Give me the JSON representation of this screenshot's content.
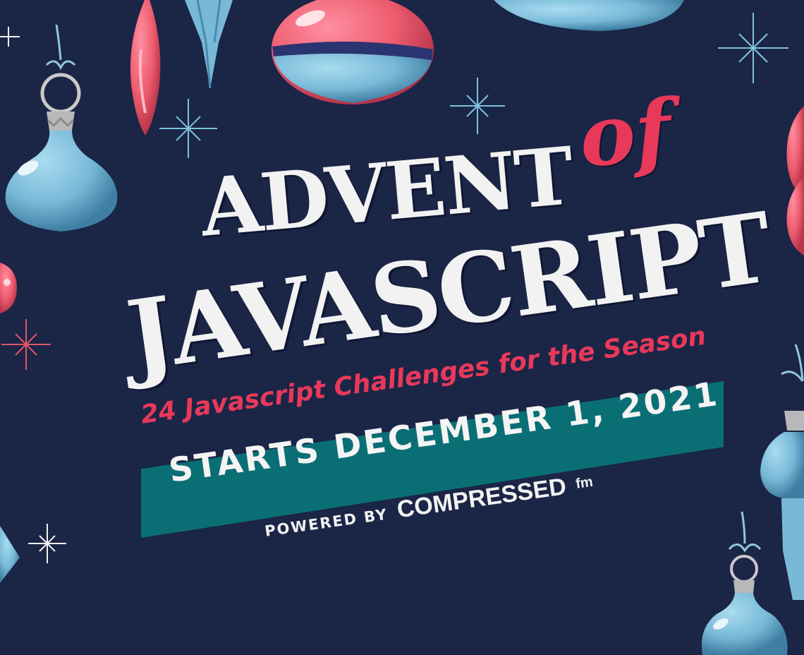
{
  "poster": {
    "title_line1": "ADVENT",
    "title_of": "of",
    "title_line2": "JAVASCRIPT",
    "subtitle": "24 Javascript Challenges for the Season",
    "start_text": "STARTS DECEMBER 1, 2021",
    "powered_by": "POWERED BY",
    "brand_name": "COMPRESSED",
    "brand_suffix": "fm"
  },
  "colors": {
    "background": "#1b2546",
    "accent_red": "#e8395a",
    "banner_teal": "#0a6f75",
    "ornament_blue": "#78b9d8",
    "text_white": "#f2f2f2"
  },
  "decorations": [
    "ornament-icon",
    "icicle-ornament-icon",
    "sparkle-star-icon"
  ]
}
